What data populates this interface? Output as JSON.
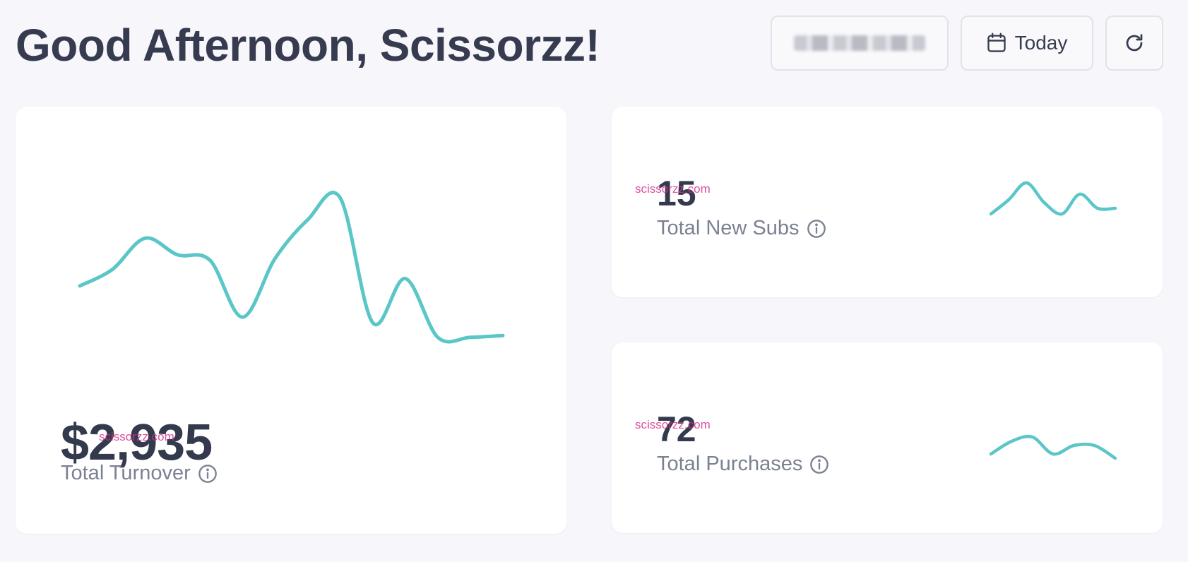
{
  "header": {
    "greeting": "Good Afternoon, Scissorzz!",
    "today_label": "Today"
  },
  "colors": {
    "accent": "#5bc6c7",
    "text": "#363b4f",
    "muted": "#7b8192",
    "card": "#ffffff",
    "background": "#f7f7fb",
    "watermark": "#d6338c"
  },
  "icons": {
    "calendar": "calendar-icon",
    "refresh": "refresh-icon",
    "info": "info-icon"
  },
  "cards": {
    "turnover": {
      "value": "$2,935",
      "label": "Total Turnover"
    },
    "new_subs": {
      "value": "15",
      "label": "Total New Subs"
    },
    "purchases": {
      "value": "72",
      "label": "Total Purchases"
    }
  },
  "watermark_text": "scissorzz.com",
  "chart_data": [
    {
      "type": "line",
      "values": [
        40,
        49,
        66,
        57,
        54,
        23,
        55,
        76,
        88,
        20,
        44,
        12,
        12,
        13
      ]
    },
    {
      "type": "line",
      "values": [
        2,
        7,
        13,
        6,
        2,
        9,
        4,
        4
      ]
    },
    {
      "type": "line",
      "values": [
        2,
        5,
        6,
        2,
        4,
        4,
        1
      ]
    }
  ]
}
